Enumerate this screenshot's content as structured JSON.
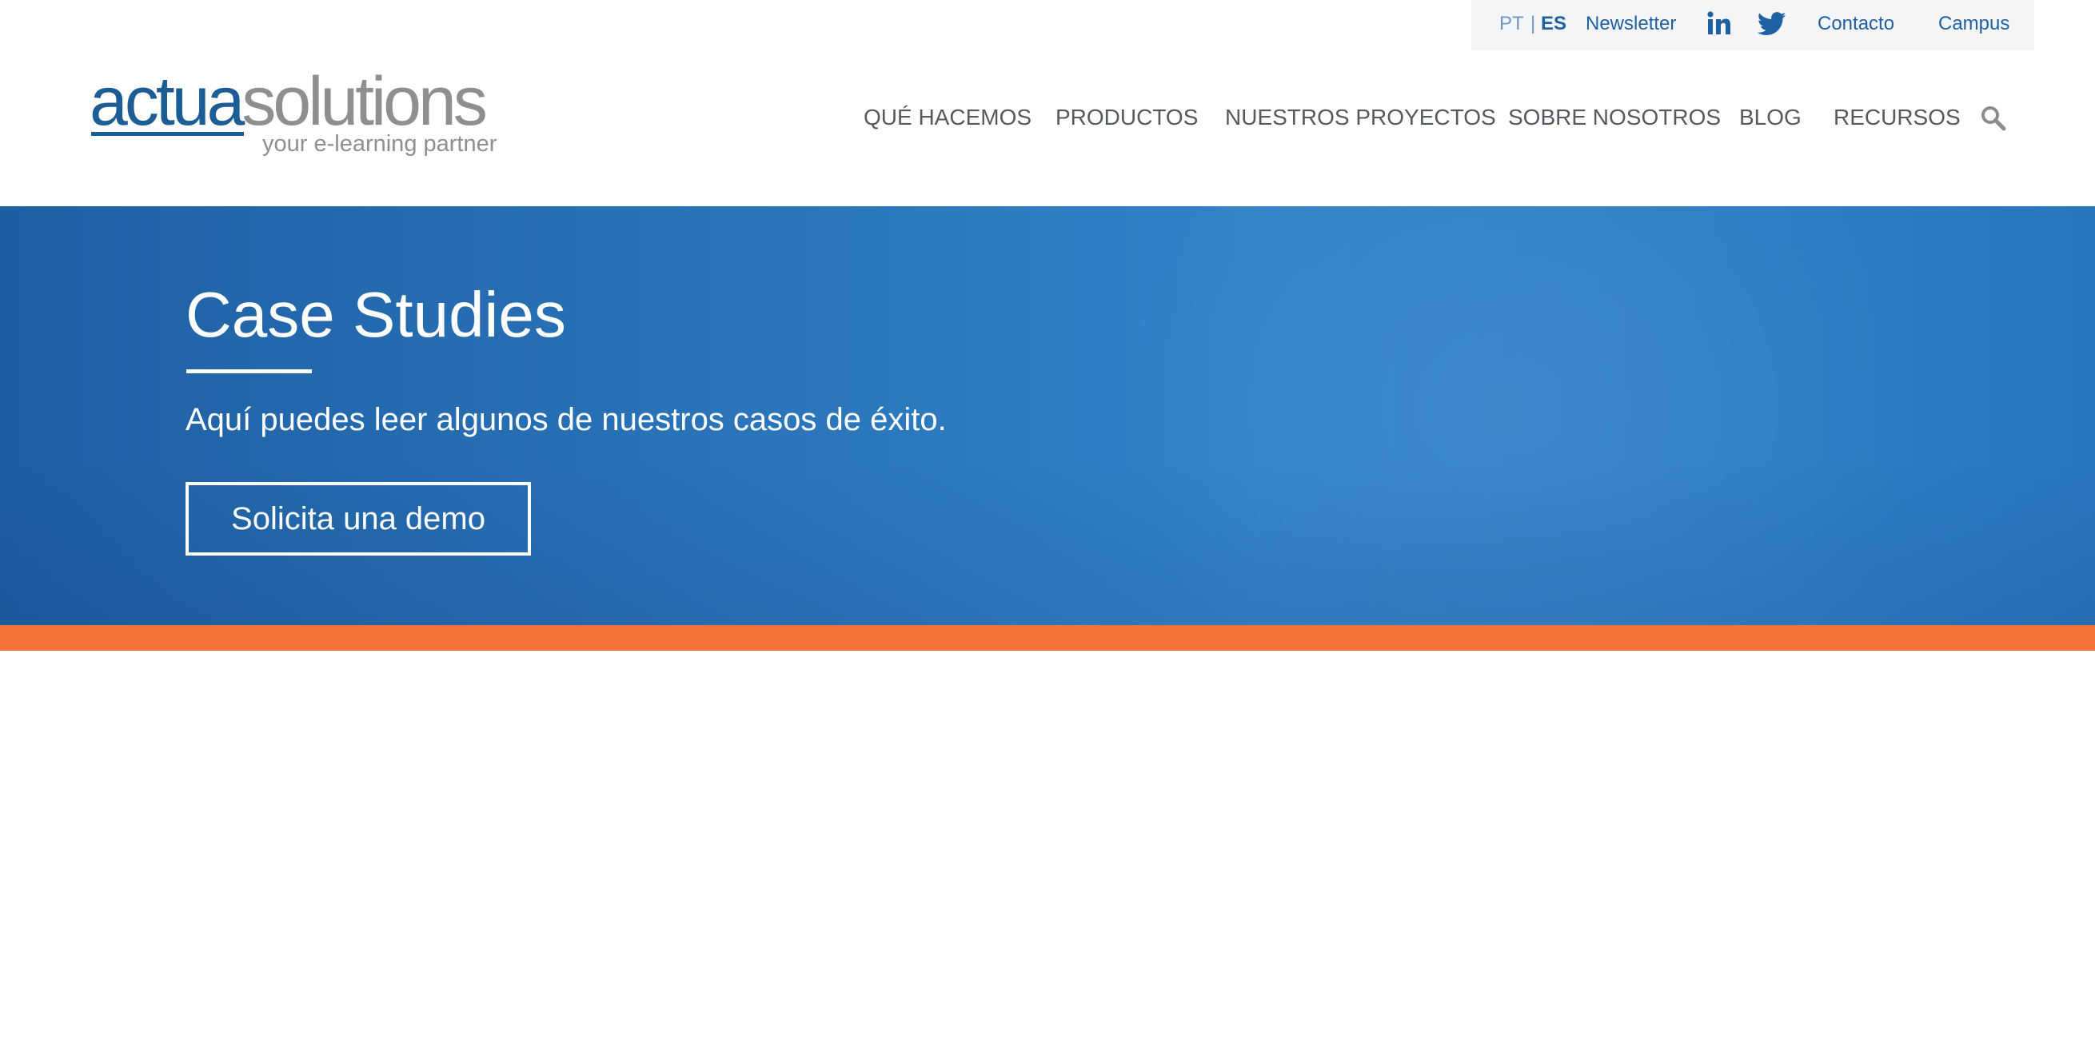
{
  "topbar": {
    "lang_pt": "PT",
    "lang_separator": "|",
    "lang_es": "ES",
    "newsletter": "Newsletter",
    "contact": "Contacto",
    "campus": "Campus",
    "icons": [
      "linkedin-icon",
      "twitter-icon"
    ]
  },
  "logo": {
    "word_part1": "actua",
    "word_part2": "solutions",
    "tagline": "your e-learning partner"
  },
  "nav": {
    "items": [
      {
        "label": "QUÉ HACEMOS"
      },
      {
        "label": "PRODUCTOS"
      },
      {
        "label": "NUESTROS PROYECTOS"
      },
      {
        "label": "SOBRE NOSOTROS"
      },
      {
        "label": "BLOG"
      },
      {
        "label": "RECURSOS"
      }
    ],
    "search_icon": "search-icon"
  },
  "hero": {
    "title": "Case Studies",
    "subtitle": "Aquí puedes leer algunos de nuestros casos de éxito.",
    "cta": "Solicita una demo"
  },
  "colors": {
    "brand_blue": "#1c5d96",
    "logo_gray": "#8f8f91",
    "hero_blue": "#2a74b9",
    "accent_orange": "#f57038",
    "link_blue": "#1f5fa3"
  }
}
